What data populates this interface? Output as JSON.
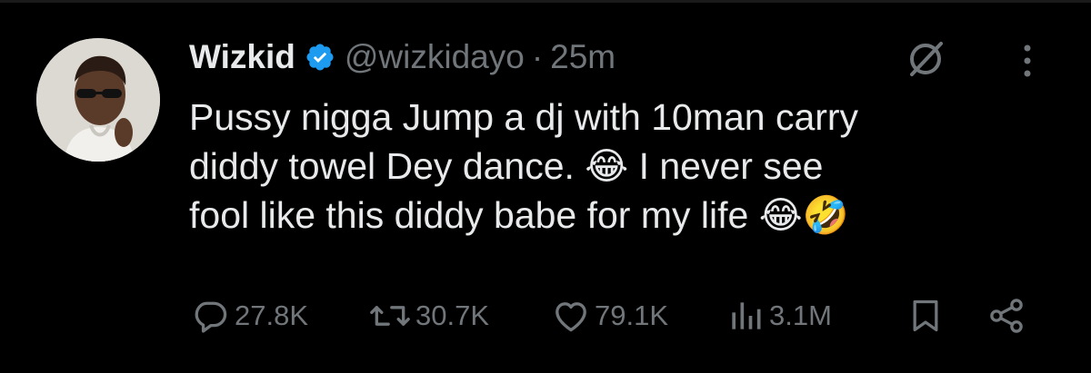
{
  "tweet": {
    "author": {
      "display_name": "Wizkid",
      "verified": true,
      "handle": "@wizkidayo",
      "separator": "·",
      "time": "25m"
    },
    "text_lines": [
      "Pussy nigga Jump a dj with 10man carry",
      "diddy towel Dey dance. 😂  I never see",
      "fool like this diddy babe for my life  😂🤣"
    ],
    "stats": {
      "replies": "27.8K",
      "reposts": "30.7K",
      "likes": "79.1K",
      "views": "3.1M"
    }
  },
  "icons": {
    "avatar": "avatar",
    "verified": "verified-badge-icon",
    "grok": "grok-icon",
    "more": "more-vertical-icon",
    "reply": "reply-icon",
    "repost": "repost-icon",
    "like": "heart-icon",
    "views": "views-icon",
    "bookmark": "bookmark-icon",
    "share": "share-icon"
  },
  "colors": {
    "background": "#000000",
    "text": "#e7e9ea",
    "muted": "#71767b",
    "verified": "#1d9bf0"
  }
}
